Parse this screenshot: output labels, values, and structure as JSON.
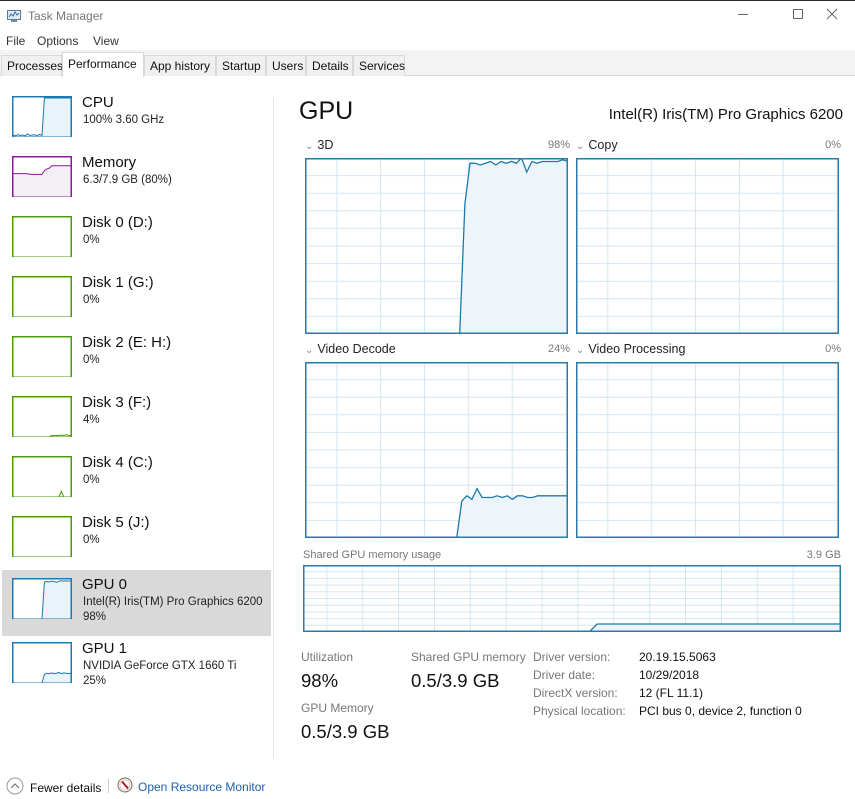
{
  "window": {
    "title": "Task Manager",
    "icon": "task-manager-icon",
    "controls": [
      "minimize-icon",
      "maximize-icon",
      "close-icon"
    ]
  },
  "menu": [
    "File",
    "Options",
    "View"
  ],
  "tabs": [
    {
      "label": "Processes",
      "active": false
    },
    {
      "label": "Performance",
      "active": true
    },
    {
      "label": "App history",
      "active": false
    },
    {
      "label": "Startup",
      "active": false
    },
    {
      "label": "Users",
      "active": false
    },
    {
      "label": "Details",
      "active": false
    },
    {
      "label": "Services",
      "active": false
    }
  ],
  "sidebar": {
    "items": [
      {
        "name": "CPU",
        "line1": "100% 3.60 GHz",
        "line2": "",
        "kind": "cpu",
        "color": "#1a7aaf",
        "fill": "#e9f3fa",
        "selected": false,
        "series": [
          5,
          3,
          6,
          4,
          5,
          3,
          8,
          4,
          5,
          6,
          3,
          7,
          4,
          100,
          100,
          100,
          100,
          100,
          100,
          100,
          100,
          100,
          100,
          100,
          100
        ]
      },
      {
        "name": "Memory",
        "line1": "6.3/7.9 GB (80%)",
        "line2": "",
        "kind": "memory",
        "color": "#8b1a9b",
        "fill": "#f4eff5",
        "selected": false,
        "series": [
          60,
          60,
          60,
          60,
          60,
          60,
          60,
          58,
          58,
          58,
          58,
          58,
          58,
          68,
          72,
          74,
          80,
          80,
          80,
          80,
          80,
          80,
          80,
          80,
          80
        ]
      },
      {
        "name": "Disk 0 (D:)",
        "line1": "0%",
        "line2": "",
        "kind": "disk",
        "color": "#4d9a0e",
        "fill": "#eff6e8",
        "selected": false,
        "series": [
          0,
          0,
          0,
          0,
          0,
          0,
          0,
          0,
          0,
          0,
          0,
          0,
          0,
          0,
          0,
          0,
          0,
          0,
          0,
          0,
          0,
          0,
          0,
          0,
          0
        ]
      },
      {
        "name": "Disk 1 (G:)",
        "line1": "0%",
        "line2": "",
        "kind": "disk",
        "color": "#4d9a0e",
        "fill": "#eff6e8",
        "selected": false,
        "series": [
          0,
          0,
          0,
          0,
          0,
          0,
          0,
          0,
          0,
          0,
          0,
          0,
          0,
          0,
          0,
          0,
          0,
          0,
          0,
          0,
          0,
          0,
          0,
          0,
          0
        ]
      },
      {
        "name": "Disk 2 (E: H:)",
        "line1": "0%",
        "line2": "",
        "kind": "disk",
        "color": "#4d9a0e",
        "fill": "#eff6e8",
        "selected": false,
        "series": [
          0,
          0,
          0,
          0,
          0,
          0,
          0,
          0,
          0,
          0,
          0,
          0,
          0,
          0,
          0,
          0,
          0,
          0,
          0,
          0,
          0,
          0,
          0,
          0,
          0
        ]
      },
      {
        "name": "Disk 3 (F:)",
        "line1": "4%",
        "line2": "",
        "kind": "disk",
        "color": "#4d9a0e",
        "fill": "#eff6e8",
        "selected": false,
        "series": [
          0,
          0,
          0,
          0,
          0,
          0,
          0,
          0,
          0,
          0,
          0,
          0,
          0,
          0,
          0,
          0,
          4,
          4,
          4,
          4,
          5,
          4,
          6,
          4,
          4
        ]
      },
      {
        "name": "Disk 4 (C:)",
        "line1": "0%",
        "line2": "",
        "kind": "disk",
        "color": "#4d9a0e",
        "fill": "#eff6e8",
        "selected": false,
        "series": [
          0,
          0,
          0,
          0,
          0,
          0,
          0,
          0,
          0,
          0,
          0,
          0,
          0,
          0,
          0,
          0,
          0,
          0,
          0,
          0,
          15,
          0,
          0,
          0,
          0
        ]
      },
      {
        "name": "Disk 5 (J:)",
        "line1": "0%",
        "line2": "",
        "kind": "disk",
        "color": "#4d9a0e",
        "fill": "#eff6e8",
        "selected": false,
        "series": [
          0,
          0,
          0,
          0,
          0,
          0,
          0,
          0,
          0,
          0,
          0,
          0,
          0,
          0,
          0,
          0,
          0,
          0,
          0,
          0,
          0,
          0,
          0,
          0,
          0
        ]
      },
      {
        "name": "GPU 0",
        "line1": "Intel(R) Iris(TM) Pro Graphics 6200",
        "line2": "98%",
        "kind": "gpu",
        "color": "#1a7aaf",
        "fill": "#e9f3fa",
        "selected": true,
        "series": [
          0,
          0,
          0,
          0,
          0,
          0,
          0,
          0,
          0,
          0,
          0,
          0,
          0,
          95,
          96,
          95,
          97,
          96,
          94,
          97,
          98,
          97,
          98,
          97,
          98
        ]
      },
      {
        "name": "GPU 1",
        "line1": "NVIDIA GeForce GTX 1660 Ti",
        "line2": "25%",
        "kind": "gpu",
        "color": "#1a7aaf",
        "fill": "#e9f3fa",
        "selected": false,
        "series": [
          0,
          0,
          0,
          0,
          0,
          0,
          0,
          0,
          0,
          0,
          0,
          0,
          0,
          22,
          25,
          24,
          26,
          24,
          25,
          27,
          24,
          26,
          25,
          24,
          25
        ]
      }
    ]
  },
  "main": {
    "title": "GPU",
    "model": "Intel(R) Iris(TM) Pro Graphics 6200",
    "graphs": [
      {
        "label": "3D",
        "percent": "98%",
        "series": [
          0,
          0,
          0,
          0,
          0,
          0,
          0,
          0,
          0,
          0,
          0,
          0,
          0,
          0,
          0,
          0,
          0,
          0,
          0,
          0,
          0,
          0,
          0,
          0,
          0,
          0,
          0,
          0,
          0,
          0,
          0,
          74,
          97,
          97,
          96,
          97,
          98,
          96,
          98,
          97,
          98,
          97,
          100,
          92,
          98,
          97,
          98,
          98,
          98,
          98,
          99,
          98
        ]
      },
      {
        "label": "Copy",
        "percent": "0%",
        "series": []
      },
      {
        "label": "Video Decode",
        "percent": "24%",
        "series": [
          0,
          0,
          0,
          0,
          0,
          0,
          0,
          0,
          0,
          0,
          0,
          0,
          0,
          0,
          0,
          0,
          0,
          0,
          0,
          0,
          0,
          0,
          0,
          0,
          0,
          0,
          0,
          0,
          0,
          0,
          0,
          21,
          24,
          22,
          28,
          23,
          23,
          23,
          24,
          23,
          24,
          22,
          24,
          24,
          23,
          23,
          24,
          24,
          24,
          24,
          24,
          24,
          24
        ]
      },
      {
        "label": "Video Processing",
        "percent": "0%",
        "series": []
      }
    ],
    "shared_memory_graph": {
      "label": "Shared GPU memory usage",
      "max": "3.9 GB",
      "series": [
        1,
        1,
        1,
        1,
        1,
        1,
        1,
        1,
        1,
        1,
        1,
        1,
        1,
        1,
        1,
        1,
        1,
        1,
        1,
        1,
        1,
        1,
        1,
        1,
        1,
        1,
        1,
        1,
        1,
        1,
        1,
        1,
        1,
        1,
        1,
        1,
        1,
        1,
        1,
        1,
        1,
        12,
        12,
        12,
        12,
        12,
        12,
        12,
        12,
        12,
        12,
        12,
        12,
        12,
        12,
        12,
        12,
        12,
        12,
        12,
        12,
        12,
        12,
        12,
        12,
        12,
        12,
        12,
        12,
        12,
        12,
        12,
        12,
        12,
        12,
        12
      ]
    },
    "stats": {
      "utilization_label": "Utilization",
      "utilization_value": "98%",
      "shared_label": "Shared GPU memory",
      "shared_value": "0.5/3.9 GB",
      "gpu_memory_label": "GPU Memory",
      "gpu_memory_value": "0.5/3.9 GB"
    },
    "details": [
      {
        "key": "Driver version:",
        "value": "20.19.15.5063"
      },
      {
        "key": "Driver date:",
        "value": "10/29/2018"
      },
      {
        "key": "DirectX version:",
        "value": "12 (FL 11.1)"
      },
      {
        "key": "Physical location:",
        "value": "PCI bus 0, device 2, function 0"
      }
    ]
  },
  "footer": {
    "fewer_details": "Fewer details",
    "open_resource_monitor": "Open Resource Monitor"
  },
  "colors": {
    "gpu_line": "#1a7aaf",
    "gpu_fill": "#eef5fa",
    "grid": "#d4e6f1",
    "selected_bg": "#d9d9d9",
    "link": "#1a5fb4"
  }
}
